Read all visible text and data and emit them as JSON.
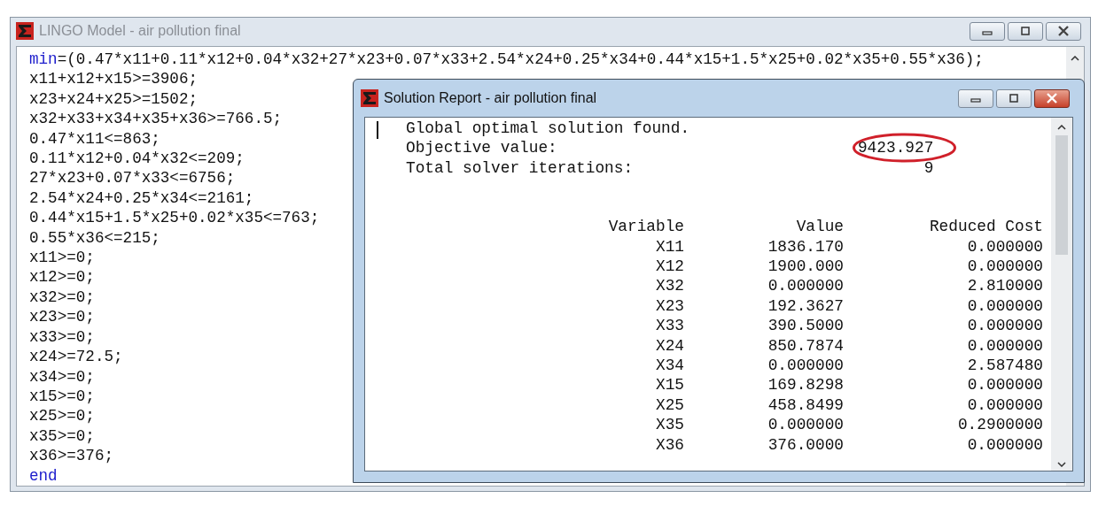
{
  "model_window": {
    "title": "LINGO Model - air pollution final",
    "active": false,
    "lines": [
      {
        "segments": [
          {
            "kind": "keyword",
            "text": "min"
          },
          {
            "kind": "plain",
            "text": "=(0.47*x11+0.11*x12+0.04*x32+27*x23+0.07*x33+2.54*x24+0.25*x34+0.44*x15+1.5*x25+0.02*x35+0.55*x36);"
          }
        ]
      },
      {
        "segments": [
          {
            "kind": "plain",
            "text": "x11+x12+x15>=3906;"
          }
        ]
      },
      {
        "segments": [
          {
            "kind": "plain",
            "text": "x23+x24+x25>=1502;"
          }
        ]
      },
      {
        "segments": [
          {
            "kind": "plain",
            "text": "x32+x33+x34+x35+x36>=766.5;"
          }
        ]
      },
      {
        "segments": [
          {
            "kind": "plain",
            "text": "0.47*x11<=863;"
          }
        ]
      },
      {
        "segments": [
          {
            "kind": "plain",
            "text": "0.11*x12+0.04*x32<=209;"
          }
        ]
      },
      {
        "segments": [
          {
            "kind": "plain",
            "text": "27*x23+0.07*x33<=6756;"
          }
        ]
      },
      {
        "segments": [
          {
            "kind": "plain",
            "text": "2.54*x24+0.25*x34<=2161;"
          }
        ]
      },
      {
        "segments": [
          {
            "kind": "plain",
            "text": "0.44*x15+1.5*x25+0.02*x35<=763;"
          }
        ]
      },
      {
        "segments": [
          {
            "kind": "plain",
            "text": "0.55*x36<=215;"
          }
        ]
      },
      {
        "segments": [
          {
            "kind": "plain",
            "text": "x11>=0;"
          }
        ]
      },
      {
        "segments": [
          {
            "kind": "plain",
            "text": "x12>=0;"
          }
        ]
      },
      {
        "segments": [
          {
            "kind": "plain",
            "text": "x32>=0;"
          }
        ]
      },
      {
        "segments": [
          {
            "kind": "plain",
            "text": "x23>=0;"
          }
        ]
      },
      {
        "segments": [
          {
            "kind": "plain",
            "text": "x33>=0;"
          }
        ]
      },
      {
        "segments": [
          {
            "kind": "plain",
            "text": "x24>=72.5;"
          }
        ]
      },
      {
        "segments": [
          {
            "kind": "plain",
            "text": "x34>=0;"
          }
        ]
      },
      {
        "segments": [
          {
            "kind": "plain",
            "text": "x15>=0;"
          }
        ]
      },
      {
        "segments": [
          {
            "kind": "plain",
            "text": "x25>=0;"
          }
        ]
      },
      {
        "segments": [
          {
            "kind": "plain",
            "text": "x35>=0;"
          }
        ]
      },
      {
        "segments": [
          {
            "kind": "plain",
            "text": "x36>=376;"
          }
        ]
      },
      {
        "segments": [
          {
            "kind": "keyword",
            "text": "end"
          }
        ]
      }
    ]
  },
  "report_window": {
    "title": "Solution Report - air pollution final",
    "active": true,
    "summary": [
      {
        "label": "Global optimal solution found.",
        "highlighted": false
      },
      {
        "label": "Objective value:",
        "value": "9423.927",
        "highlighted": true
      },
      {
        "label": "Total solver iterations:",
        "value": "9",
        "highlighted": false
      }
    ],
    "columns": [
      "Variable",
      "Value",
      "Reduced Cost"
    ],
    "rows": [
      [
        "X11",
        "1836.170",
        "0.000000"
      ],
      [
        "X12",
        "1900.000",
        "0.000000"
      ],
      [
        "X32",
        "0.000000",
        "2.810000"
      ],
      [
        "X23",
        "192.3627",
        "0.000000"
      ],
      [
        "X33",
        "390.5000",
        "0.000000"
      ],
      [
        "X24",
        "850.7874",
        "0.000000"
      ],
      [
        "X34",
        "0.000000",
        "2.587480"
      ],
      [
        "X15",
        "169.8298",
        "0.000000"
      ],
      [
        "X25",
        "458.8499",
        "0.000000"
      ],
      [
        "X35",
        "0.000000",
        "0.2900000"
      ],
      [
        "X36",
        "376.0000",
        "0.000000"
      ]
    ]
  }
}
